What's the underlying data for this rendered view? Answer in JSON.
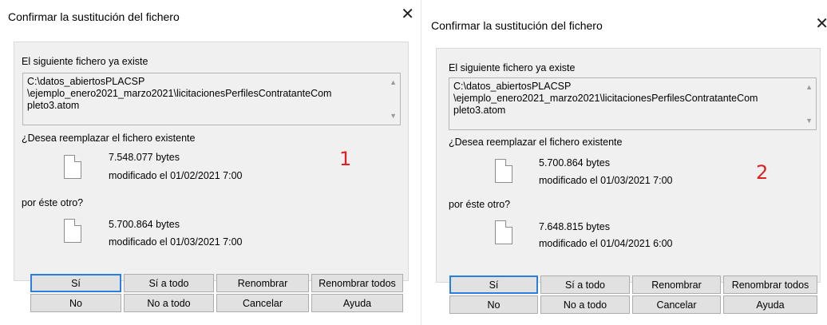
{
  "dialogs": [
    {
      "title": "Confirmar la sustitución del fichero",
      "exists_label": "El siguiente fichero ya existe",
      "path_lines": [
        "C:\\datos_abiertosPLACSP",
        "\\ejemplo_enero2021_marzo2021\\licitacionesPerfilesContratanteCom",
        "pleto3.atom"
      ],
      "replace_question": "¿Desea reemplazar el fichero existente",
      "existing": {
        "size": "7.548.077 bytes",
        "modified": "modificado el 01/02/2021 7:00"
      },
      "with_label": "por éste otro?",
      "new": {
        "size": "5.700.864 bytes",
        "modified": "modificado el 01/03/2021 7:00"
      },
      "marker": "1",
      "buttons": {
        "yes": "Sí",
        "yes_all": "Sí a todo",
        "rename": "Renombrar",
        "rename_all": "Renombrar todos",
        "no": "No",
        "no_all": "No a todo",
        "cancel": "Cancelar",
        "help": "Ayuda"
      }
    },
    {
      "title": "Confirmar la sustitución del fichero",
      "exists_label": "El siguiente fichero ya existe",
      "path_lines": [
        "C:\\datos_abiertosPLACSP",
        "\\ejemplo_enero2021_marzo2021\\licitacionesPerfilesContratanteCom",
        "pleto3.atom"
      ],
      "replace_question": "¿Desea reemplazar el fichero existente",
      "existing": {
        "size": "5.700.864 bytes",
        "modified": "modificado el 01/03/2021 7:00"
      },
      "with_label": "por éste otro?",
      "new": {
        "size": "7.648.815 bytes",
        "modified": "modificado el 01/04/2021 6:00"
      },
      "marker": "2",
      "buttons": {
        "yes": "Sí",
        "yes_all": "Sí a todo",
        "rename": "Renombrar",
        "rename_all": "Renombrar todos",
        "no": "No",
        "no_all": "No a todo",
        "cancel": "Cancelar",
        "help": "Ayuda"
      }
    }
  ],
  "icons": {
    "close": "close-icon",
    "file": "file-icon",
    "scroll_up": "scroll-up-icon",
    "scroll_down": "scroll-down-icon"
  },
  "colors": {
    "default_button_border": "#2a7de1",
    "marker": "#e02020"
  }
}
